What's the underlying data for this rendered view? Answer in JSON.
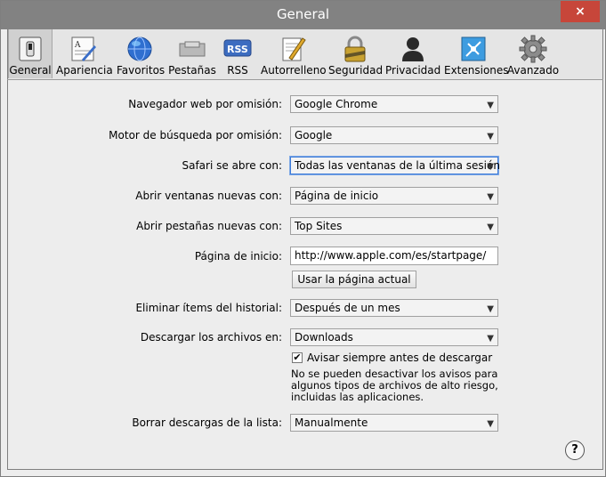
{
  "window": {
    "title": "General",
    "close_glyph": "×"
  },
  "toolbar": {
    "items": [
      {
        "label": "General",
        "icon": "general-switch-icon",
        "selected": true
      },
      {
        "label": "Apariencia",
        "icon": "appearance-icon"
      },
      {
        "label": "Favoritos",
        "icon": "globe-icon"
      },
      {
        "label": "Pestañas",
        "icon": "tabs-icon"
      },
      {
        "label": "RSS",
        "icon": "rss-icon"
      },
      {
        "label": "Autorrelleno",
        "icon": "autofill-pencil-icon"
      },
      {
        "label": "Seguridad",
        "icon": "lock-icon"
      },
      {
        "label": "Privacidad",
        "icon": "privacy-person-icon"
      },
      {
        "label": "Extensiones",
        "icon": "extensions-icon"
      },
      {
        "label": "Avanzado",
        "icon": "gear-icon"
      }
    ]
  },
  "form": {
    "default_browser": {
      "label": "Navegador web por omisión:",
      "value": "Google Chrome"
    },
    "default_search": {
      "label": "Motor de búsqueda por omisión:",
      "value": "Google"
    },
    "safari_opens_with": {
      "label": "Safari se abre con:",
      "value": "Todas las ventanas de la última sesión"
    },
    "new_windows": {
      "label": "Abrir ventanas nuevas con:",
      "value": "Página de inicio"
    },
    "new_tabs": {
      "label": "Abrir pestañas nuevas con:",
      "value": "Top Sites"
    },
    "homepage": {
      "label": "Página de inicio:",
      "value": "http://www.apple.com/es/startpage/"
    },
    "use_current_page": {
      "label": "Usar la página actual"
    },
    "remove_history": {
      "label": "Eliminar ítems del historial:",
      "value": "Después de un mes"
    },
    "save_downloads": {
      "label": "Descargar los archivos en:",
      "value": "Downloads"
    },
    "ask_before_download": {
      "label": "Avisar siempre antes de descargar",
      "checked": true
    },
    "download_note": "No se pueden desactivar los avisos para algunos tipos de archivos de alto riesgo, incluidas las aplicaciones.",
    "clear_downloads": {
      "label": "Borrar descargas de la lista:",
      "value": "Manualmente"
    }
  },
  "help": {
    "label": "?"
  },
  "colors": {
    "titlebar": "#828282",
    "close": "#c7463a",
    "panel": "#ededed",
    "focus": "#3d7bd8"
  }
}
